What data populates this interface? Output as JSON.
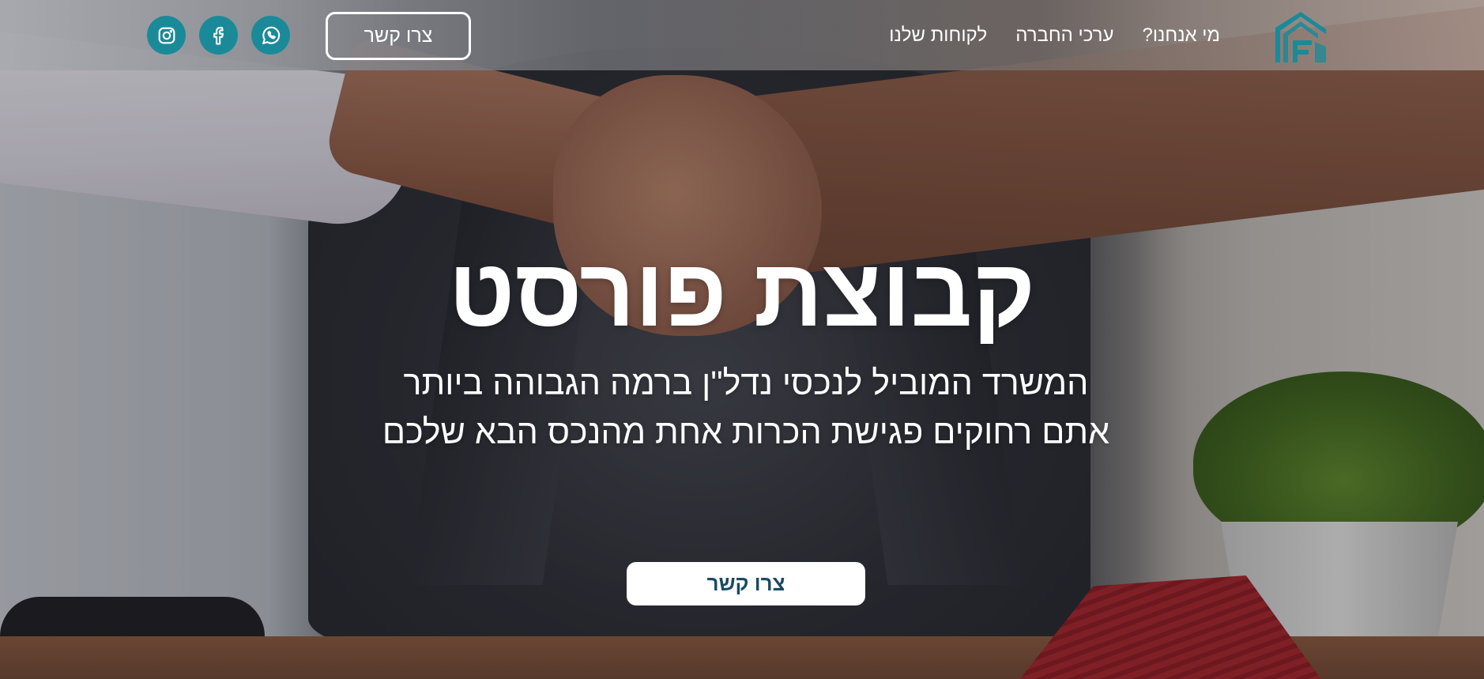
{
  "header": {
    "logo": "forest-group-logo",
    "nav": [
      {
        "label": "מי אנחנו?"
      },
      {
        "label": "ערכי החברה"
      },
      {
        "label": "לקוחות שלנו"
      }
    ],
    "contact_label": "צרו קשר",
    "social": [
      {
        "icon": "whatsapp-icon"
      },
      {
        "icon": "facebook-icon"
      },
      {
        "icon": "instagram-icon"
      }
    ]
  },
  "hero": {
    "title": "קבוצת פורסט",
    "subtitle_line1": "המשרד המוביל לנכסי נדל\"ן ברמה הגבוהה ביותר",
    "subtitle_line2": "אתם רחוקים פגישת הכרות אחת מהנכס הבא שלכם",
    "cta_label": "צרו קשר"
  },
  "colors": {
    "accent": "#1b8a98",
    "cta_text": "#1b4a63",
    "white": "#ffffff"
  }
}
